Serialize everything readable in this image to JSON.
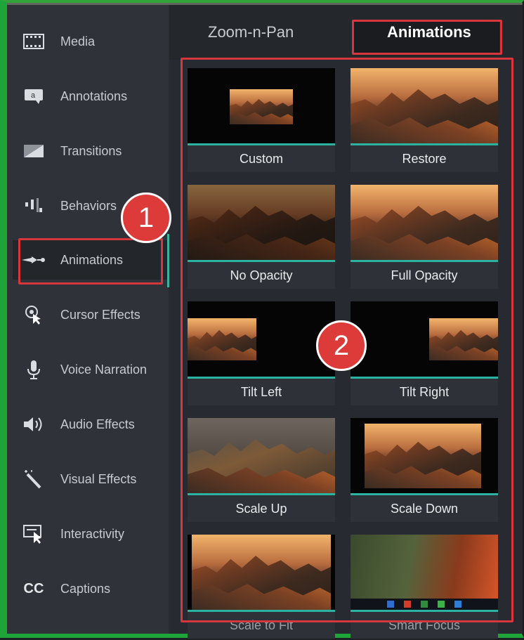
{
  "sidebar": {
    "items": [
      {
        "label": "Media",
        "icon": "film-icon"
      },
      {
        "label": "Annotations",
        "icon": "annotation-icon"
      },
      {
        "label": "Transitions",
        "icon": "transition-icon"
      },
      {
        "label": "Behaviors",
        "icon": "behaviors-icon"
      },
      {
        "label": "Animations",
        "icon": "animation-icon"
      },
      {
        "label": "Cursor Effects",
        "icon": "cursor-effects-icon"
      },
      {
        "label": "Voice Narration",
        "icon": "microphone-icon"
      },
      {
        "label": "Audio Effects",
        "icon": "speaker-icon"
      },
      {
        "label": "Visual Effects",
        "icon": "magic-wand-icon"
      },
      {
        "label": "Interactivity",
        "icon": "interactivity-icon"
      },
      {
        "label": "Captions",
        "icon": "captions-icon"
      }
    ],
    "active": "Animations",
    "captions_glyph": "CC"
  },
  "tabs": [
    {
      "label": "Zoom-n-Pan"
    },
    {
      "label": "Animations"
    }
  ],
  "active_tab": "Animations",
  "animations": [
    {
      "label": "Custom"
    },
    {
      "label": "Restore"
    },
    {
      "label": "No Opacity"
    },
    {
      "label": "Full Opacity"
    },
    {
      "label": "Tilt Left"
    },
    {
      "label": "Tilt Right"
    },
    {
      "label": "Scale Up"
    },
    {
      "label": "Scale Down"
    },
    {
      "label": "Scale to Fit"
    },
    {
      "label": "Smart Focus"
    }
  ],
  "annotations": {
    "badge_1": "1",
    "badge_2": "2"
  },
  "colors": {
    "highlight": "#d6363c",
    "accent": "#2bb3a1",
    "border": "#1fa43a"
  }
}
